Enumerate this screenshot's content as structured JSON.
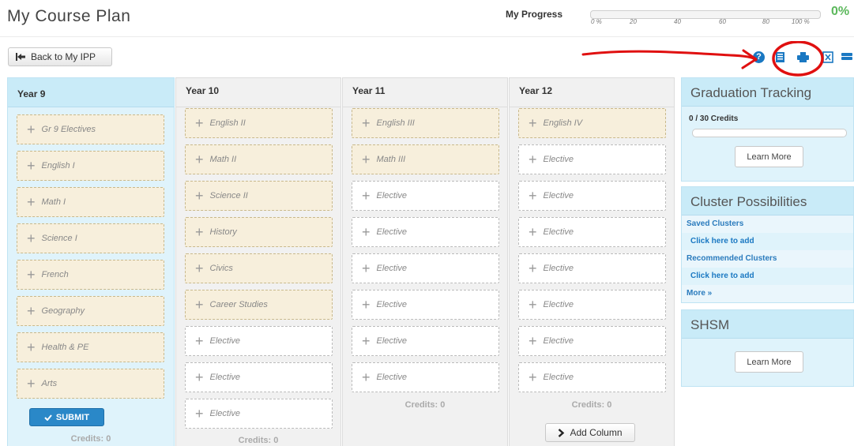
{
  "header": {
    "title": "My Course Plan",
    "progress_label": "My Progress",
    "progress_ticks": [
      "0 %",
      "20",
      "40",
      "60",
      "80",
      "100 %"
    ],
    "progress_value": "0%",
    "back_button": "Back to My IPP"
  },
  "toolbar_icons": [
    "help-icon",
    "notebook-icon",
    "print-icon",
    "export-icon",
    "stack-icon"
  ],
  "columns": [
    {
      "title": "Year 9",
      "courses": [
        "Gr 9 Electives",
        "English I",
        "Math I",
        "Science I",
        "French",
        "Geography",
        "Health & PE",
        "Arts"
      ],
      "submit_label": "SUBMIT",
      "credits": "Credits: 0"
    },
    {
      "title": "Year 10",
      "courses": [
        "English II",
        "Math II",
        "Science II",
        "History",
        "Civics",
        "Career Studies",
        "Elective",
        "Elective",
        "Elective"
      ],
      "credits": "Credits: 0"
    },
    {
      "title": "Year 11",
      "courses": [
        "English III",
        "Math III",
        "Elective",
        "Elective",
        "Elective",
        "Elective",
        "Elective",
        "Elective"
      ],
      "credits": "Credits: 0"
    },
    {
      "title": "Year 12",
      "courses": [
        "English IV",
        "Elective",
        "Elective",
        "Elective",
        "Elective",
        "Elective",
        "Elective",
        "Elective"
      ],
      "credits": "Credits: 0",
      "add_column_label": "Add Column"
    }
  ],
  "graduation": {
    "title": "Graduation Tracking",
    "credits": "0 / 30 Credits",
    "learn_more": "Learn More"
  },
  "clusters": {
    "title": "Cluster Possibilities",
    "saved_label": "Saved Clusters",
    "saved_link": "Click here to add",
    "recommended_label": "Recommended Clusters",
    "recommended_link": "Click here to add",
    "more_link": "More »"
  },
  "shsm": {
    "title": "SHSM",
    "learn_more": "Learn More"
  },
  "colors": {
    "accent": "#1a78c2",
    "panel_bg": "#dff3fb",
    "course_card": "#f7efdc",
    "progress_green": "#5cb85c",
    "annotation_red": "#e01010"
  }
}
